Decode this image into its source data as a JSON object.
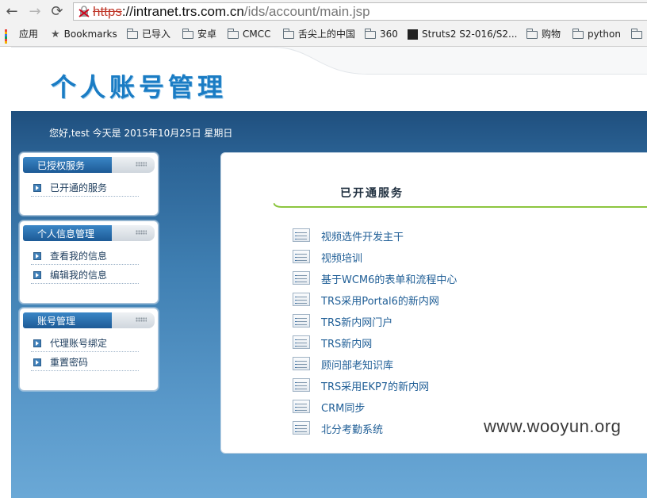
{
  "browser": {
    "url_scheme": "https",
    "url_host": "://intranet.trs.com.cn",
    "url_path": "/ids/account/main.jsp",
    "bookmarks": [
      "应用",
      "Bookmarks",
      "已导入",
      "安卓",
      "CMCC",
      "舌尖上的中国",
      "360",
      "Struts2 S2-016/S2...",
      "购物",
      "python"
    ]
  },
  "header": {
    "logo_text": "个人账号管理",
    "greeting": "您好,test 今天是 2015年10月25日 星期日"
  },
  "sidebar": {
    "panels": [
      {
        "title": "已授权服务",
        "items": [
          "已开通的服务"
        ]
      },
      {
        "title": "个人信息管理",
        "items": [
          "查看我的信息",
          "编辑我的信息"
        ]
      },
      {
        "title": "账号管理",
        "items": [
          "代理账号绑定",
          "重置密码"
        ]
      }
    ]
  },
  "main": {
    "title": "已开通服务",
    "services": [
      "视频选件开发主干",
      "视频培训",
      "基于WCM6的表单和流程中心",
      "TRS采用Portal6的新内网",
      "TRS新内网门户",
      "TRS新内网",
      "顾问部老知识库",
      "TRS采用EKP7的新内网",
      "CRM同步",
      "北分考勤系统"
    ]
  },
  "watermark": "www.wooyun.org",
  "colors": {
    "logo": "#1a7cc4",
    "banner_top": "#1f4f7e",
    "banner_bottom": "#6aa8d6",
    "link": "#1f5e96",
    "accent_line": "#8cc63f"
  }
}
